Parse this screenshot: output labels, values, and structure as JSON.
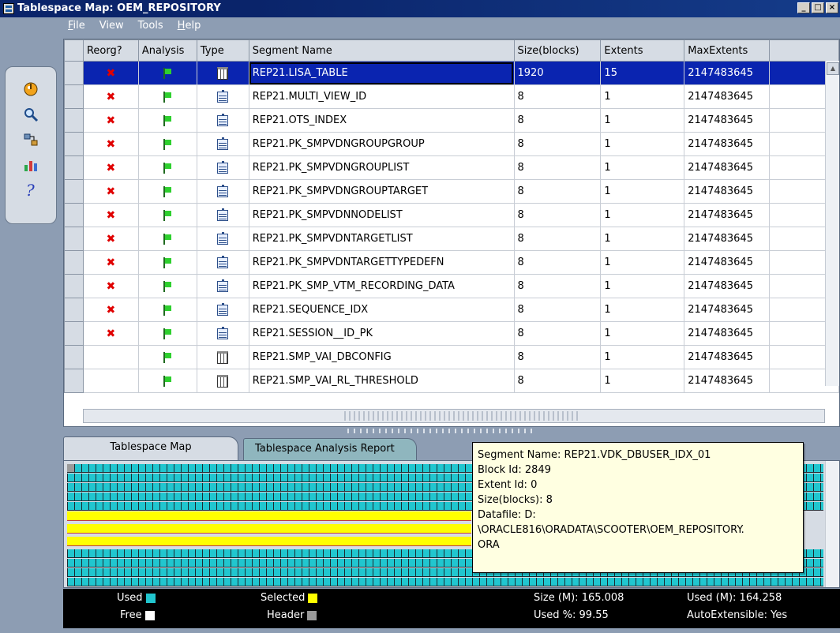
{
  "window": {
    "title": "Tablespace Map: OEM_REPOSITORY",
    "min_label": "_",
    "max_label": "□",
    "close_label": "×"
  },
  "menu": [
    "File",
    "View",
    "Tools",
    "Help"
  ],
  "toolbar": {
    "icons": [
      "exit-icon",
      "find-icon",
      "reorganize-icon",
      "analyze-icon",
      "help-icon"
    ]
  },
  "grid": {
    "columns": [
      "Reorg?",
      "Analysis",
      "Type",
      "Segment Name",
      "Size(blocks)",
      "Extents",
      "MaxExtents"
    ],
    "rows": [
      {
        "reorg": "x",
        "type": "table",
        "name": "REP21.LISA_TABLE",
        "size": "1920",
        "extents": "15",
        "max": "2147483645",
        "selected": true
      },
      {
        "reorg": "x",
        "type": "index",
        "name": "REP21.MULTI_VIEW_ID",
        "size": "8",
        "extents": "1",
        "max": "2147483645"
      },
      {
        "reorg": "x",
        "type": "index",
        "name": "REP21.OTS_INDEX",
        "size": "8",
        "extents": "1",
        "max": "2147483645"
      },
      {
        "reorg": "x",
        "type": "index",
        "name": "REP21.PK_SMPVDNGROUPGROUP",
        "size": "8",
        "extents": "1",
        "max": "2147483645"
      },
      {
        "reorg": "x",
        "type": "index",
        "name": "REP21.PK_SMPVDNGROUPLIST",
        "size": "8",
        "extents": "1",
        "max": "2147483645"
      },
      {
        "reorg": "x",
        "type": "index",
        "name": "REP21.PK_SMPVDNGROUPTARGET",
        "size": "8",
        "extents": "1",
        "max": "2147483645"
      },
      {
        "reorg": "x",
        "type": "index",
        "name": "REP21.PK_SMPVDNNODELIST",
        "size": "8",
        "extents": "1",
        "max": "2147483645"
      },
      {
        "reorg": "x",
        "type": "index",
        "name": "REP21.PK_SMPVDNTARGETLIST",
        "size": "8",
        "extents": "1",
        "max": "2147483645"
      },
      {
        "reorg": "x",
        "type": "index",
        "name": "REP21.PK_SMPVDNTARGETTYPEDEFN",
        "size": "8",
        "extents": "1",
        "max": "2147483645"
      },
      {
        "reorg": "x",
        "type": "index",
        "name": "REP21.PK_SMP_VTM_RECORDING_DATA",
        "size": "8",
        "extents": "1",
        "max": "2147483645"
      },
      {
        "reorg": "x",
        "type": "index",
        "name": "REP21.SEQUENCE_IDX",
        "size": "8",
        "extents": "1",
        "max": "2147483645"
      },
      {
        "reorg": "x",
        "type": "index",
        "name": "REP21.SESSION__ID_PK",
        "size": "8",
        "extents": "1",
        "max": "2147483645"
      },
      {
        "reorg": "",
        "type": "table",
        "name": "REP21.SMP_VAI_DBCONFIG",
        "size": "8",
        "extents": "1",
        "max": "2147483645"
      },
      {
        "reorg": "",
        "type": "table",
        "name": "REP21.SMP_VAI_RL_THRESHOLD",
        "size": "8",
        "extents": "1",
        "max": "2147483645"
      }
    ]
  },
  "tabs": {
    "map": "Tablespace Map",
    "report": "Tablespace Analysis Report"
  },
  "tooltip": {
    "lines": [
      "Segment Name: REP21.VDK_DBUSER_IDX_01",
      "Block Id: 2849",
      "Extent Id: 0",
      "Size(blocks): 8",
      "Datafile: D:",
      "\\ORACLE816\\ORADATA\\SCOOTER\\OEM_REPOSITORY.",
      "ORA"
    ]
  },
  "legend": {
    "used": "Used",
    "free": "Free",
    "selected": "Selected",
    "header": "Header",
    "size": "Size (M): 165.008",
    "used_pct": "Used %: 99.55",
    "used_m": "Used (M): 164.258",
    "autoext": "AutoExtensible: Yes"
  },
  "colors": {
    "used": "#21c6cf",
    "free": "#ffffff",
    "selected": "#ffff00",
    "header": "#9a9a9a"
  }
}
